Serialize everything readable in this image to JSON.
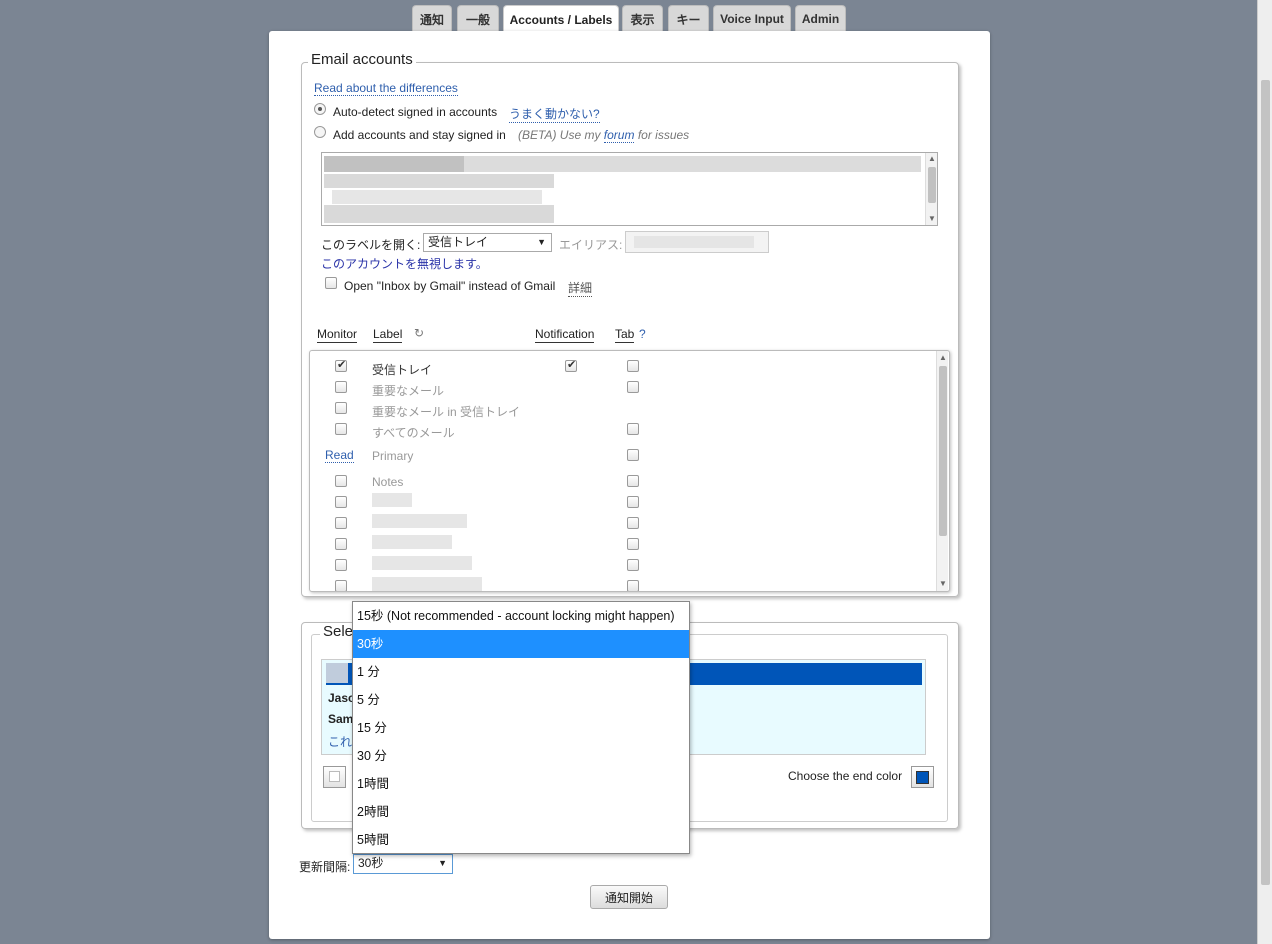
{
  "tabs": [
    {
      "label": "通知",
      "active": false
    },
    {
      "label": "一般",
      "active": false
    },
    {
      "label": "Accounts / Labels",
      "active": true
    },
    {
      "label": "表示",
      "active": false
    },
    {
      "label": "キー",
      "active": false
    },
    {
      "label": "Voice Input",
      "active": false
    },
    {
      "label": "Admin",
      "active": false
    }
  ],
  "email_accounts": {
    "legend": "Email accounts",
    "read_link": "Read about the differences",
    "option_auto": "Auto-detect signed in accounts",
    "option_auto_help": "うまく動かない?",
    "option_add": "Add accounts and stay signed in",
    "option_add_note_pre": "(BETA) Use my",
    "option_add_note_link": "forum",
    "option_add_note_post": "for issues",
    "open_label_caption": "このラベルを開く:",
    "open_label_value": "受信トレイ",
    "alias_caption": "エイリアス:",
    "ignore_account_link": "このアカウントを無視します。",
    "inbox_by_gmail_label": "Open \"Inbox by Gmail\" instead of Gmail",
    "details_link": "詳細"
  },
  "labels_table": {
    "headers": {
      "monitor": "Monitor",
      "label": "Label",
      "notification": "Notification",
      "tab": "Tab",
      "tab_help": "?"
    },
    "read_link": "Read",
    "rows": [
      {
        "label": "受信トレイ",
        "monitor": true,
        "notification": true,
        "tab": false,
        "dark": true
      },
      {
        "label": "重要なメール",
        "monitor": false,
        "tab": false
      },
      {
        "label": "重要なメール in 受信トレイ",
        "monitor": false
      },
      {
        "label": "すべてのメール",
        "monitor": false,
        "tab": false
      },
      {
        "label": "Primary",
        "tab": false
      },
      {
        "label": "Notes",
        "monitor": false,
        "tab": false
      }
    ]
  },
  "select_section": {
    "legend_partial": "Sele",
    "row1_partial": "Jasc",
    "row2_partial": "Sam",
    "row3_partial": "これ",
    "end_color_label": "Choose the end color",
    "accent_color": "#0055b8"
  },
  "interval_dropdown": {
    "options": [
      "15秒 (Not recommended - account locking might happen)",
      "30秒",
      "1 分",
      "5 分",
      "15 分",
      "30 分",
      "1時間",
      "2時間",
      "5時間"
    ],
    "selected_index": 1
  },
  "footer": {
    "interval_label": "更新間隔:",
    "interval_value": "30秒",
    "start_button": "通知開始"
  }
}
